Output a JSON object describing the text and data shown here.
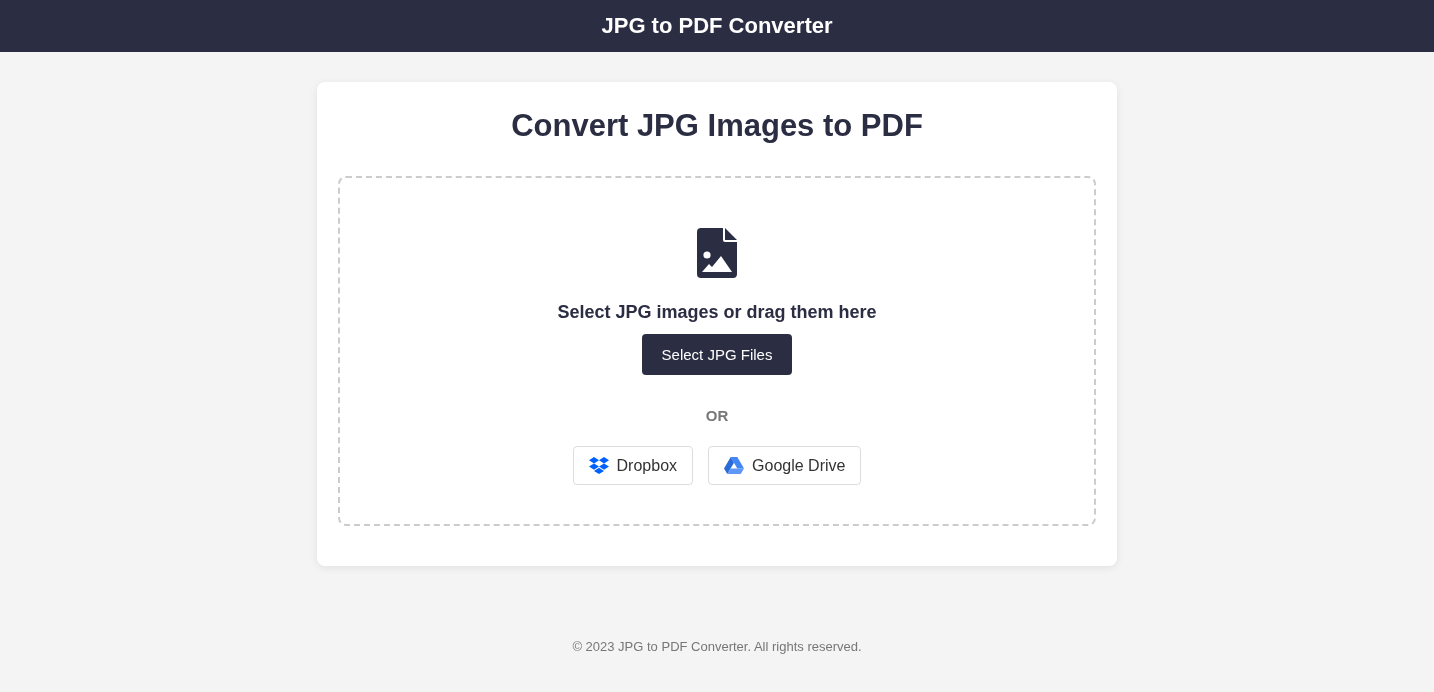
{
  "header": {
    "title": "JPG to PDF Converter"
  },
  "card": {
    "heading": "Convert JPG Images to PDF",
    "dropzone": {
      "prompt": "Select JPG images or drag them here",
      "button": "Select JPG Files",
      "separator": "OR",
      "sources": [
        {
          "kind": "dropbox",
          "label": "Dropbox"
        },
        {
          "kind": "google_drive",
          "label": "Google Drive"
        }
      ]
    }
  },
  "footer": {
    "text": "© 2023 JPG to PDF Converter. All rights reserved."
  }
}
